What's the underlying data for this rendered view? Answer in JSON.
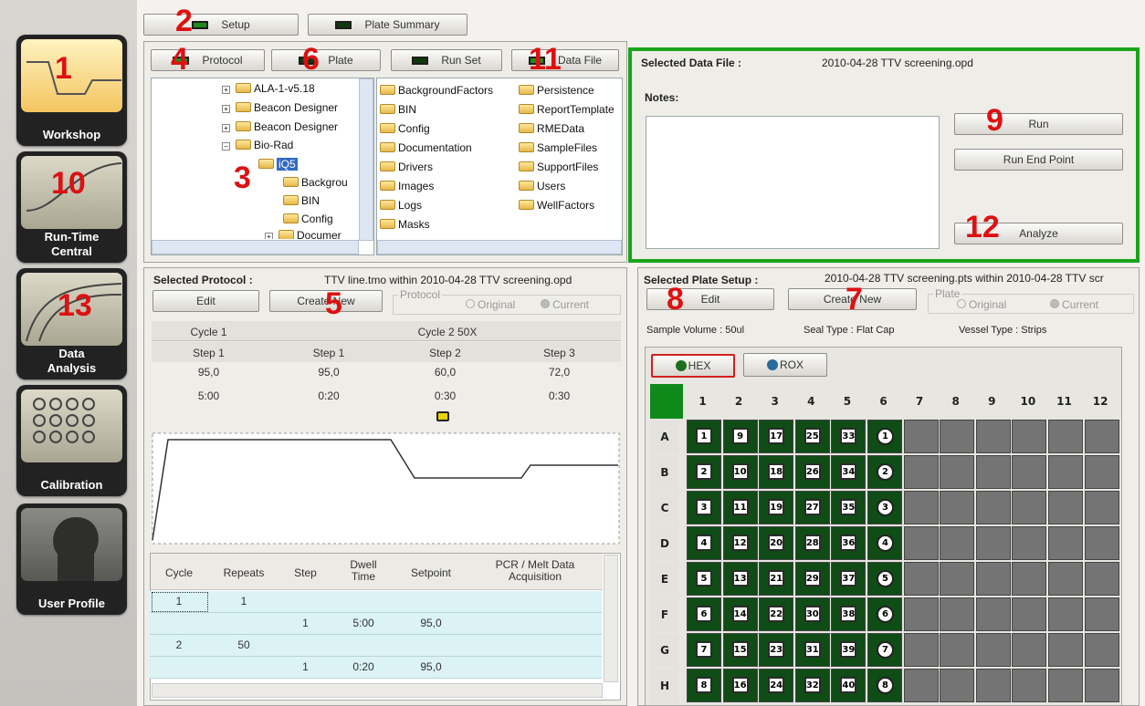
{
  "sidebar": {
    "items": [
      {
        "label": "Workshop",
        "annotation": "1"
      },
      {
        "label": "Run-Time\nCentral",
        "annotation": "10"
      },
      {
        "label": "Data\nAnalysis",
        "annotation": "13"
      },
      {
        "label": "Calibration"
      },
      {
        "label": "User Profile"
      }
    ]
  },
  "top_tabs": {
    "setup": "Setup",
    "plate_summary": "Plate Summary",
    "setup_annotation": "2"
  },
  "sub_tabs": {
    "protocol": "Protocol",
    "plate": "Plate",
    "run_set": "Run Set",
    "data_file": "Data File",
    "protocol_annotation": "4",
    "plate_annotation": "6",
    "data_file_annotation": "11"
  },
  "tree": {
    "items": [
      "ALA-1-v5.18",
      "Beacon Designer",
      "Beacon Designer",
      "Bio-Rad",
      "iQ5",
      "Backgrou",
      "BIN",
      "Config",
      "Documer"
    ],
    "annotation": "3"
  },
  "folders": {
    "col1": [
      "BackgroundFactors",
      "BIN",
      "Config",
      "Documentation",
      "Drivers",
      "Images",
      "Logs",
      "Masks"
    ],
    "col2": [
      "Persistence",
      "ReportTemplate",
      "RMEData",
      "SampleFiles",
      "SupportFiles",
      "Users",
      "WellFactors"
    ]
  },
  "data_file": {
    "selected_label": "Selected Data File :",
    "selected_value": "2010-04-28 TTV screening.opd",
    "notes_label": "Notes:",
    "run": "Run",
    "run_end_point": "Run End Point",
    "analyze": "Analyze",
    "run_annotation": "9",
    "analyze_annotation": "12"
  },
  "protocol": {
    "selected_label": "Selected Protocol :",
    "selected_value": "TTV line.tmo within 2010-04-28 TTV screening.opd",
    "edit": "Edit",
    "create_new": "Create New",
    "edit_create_annotation": "5",
    "group_label": "Protocol",
    "original": "Original",
    "current": "Current",
    "cycle1": "Cycle 1",
    "cycle2": "Cycle 2 50X",
    "steps": [
      {
        "name": "Step 1",
        "temp": "95,0",
        "time": "5:00"
      },
      {
        "name": "Step 1",
        "temp": "95,0",
        "time": "0:20"
      },
      {
        "name": "Step 2",
        "temp": "60,0",
        "time": "0:30"
      },
      {
        "name": "Step 3",
        "temp": "72,0",
        "time": "0:30"
      }
    ],
    "table_headers": [
      "Cycle",
      "Repeats",
      "Step",
      "Dwell\nTime",
      "Setpoint",
      "PCR / Melt Data\nAcquisition"
    ],
    "table_rows": [
      [
        "1",
        "1",
        "",
        "",
        "",
        ""
      ],
      [
        "",
        "",
        "1",
        "5:00",
        "95,0",
        ""
      ],
      [
        "2",
        "50",
        "",
        "",
        "",
        ""
      ],
      [
        "",
        "",
        "1",
        "0:20",
        "95,0",
        ""
      ]
    ]
  },
  "plate": {
    "selected_label": "Selected Plate Setup :",
    "selected_value": "2010-04-28 TTV screening.pts within 2010-04-28 TTV scr",
    "edit": "Edit",
    "create_new": "Create New",
    "edit_annotation": "8",
    "create_annotation": "7",
    "group_label": "Plate",
    "original": "Original",
    "current": "Current",
    "sample_volume": "Sample Volume : 50ul",
    "seal_type": "Seal Type : Flat Cap",
    "vessel_type": "Vessel Type : Strips",
    "dyes": [
      "HEX",
      "ROX"
    ],
    "columns": [
      "1",
      "2",
      "3",
      "4",
      "5",
      "6",
      "7",
      "8",
      "9",
      "10",
      "11",
      "12"
    ],
    "rows": [
      "A",
      "B",
      "C",
      "D",
      "E",
      "F",
      "G",
      "H"
    ],
    "wells": [
      [
        "1",
        "9",
        "17",
        "25",
        "33",
        "1"
      ],
      [
        "2",
        "10",
        "18",
        "26",
        "34",
        "2"
      ],
      [
        "3",
        "11",
        "19",
        "27",
        "35",
        "3"
      ],
      [
        "4",
        "12",
        "20",
        "28",
        "36",
        "4"
      ],
      [
        "5",
        "13",
        "21",
        "29",
        "37",
        "5"
      ],
      [
        "6",
        "14",
        "22",
        "30",
        "38",
        "6"
      ],
      [
        "7",
        "15",
        "23",
        "31",
        "39",
        "7"
      ],
      [
        "8",
        "16",
        "24",
        "32",
        "40",
        "8"
      ]
    ]
  }
}
